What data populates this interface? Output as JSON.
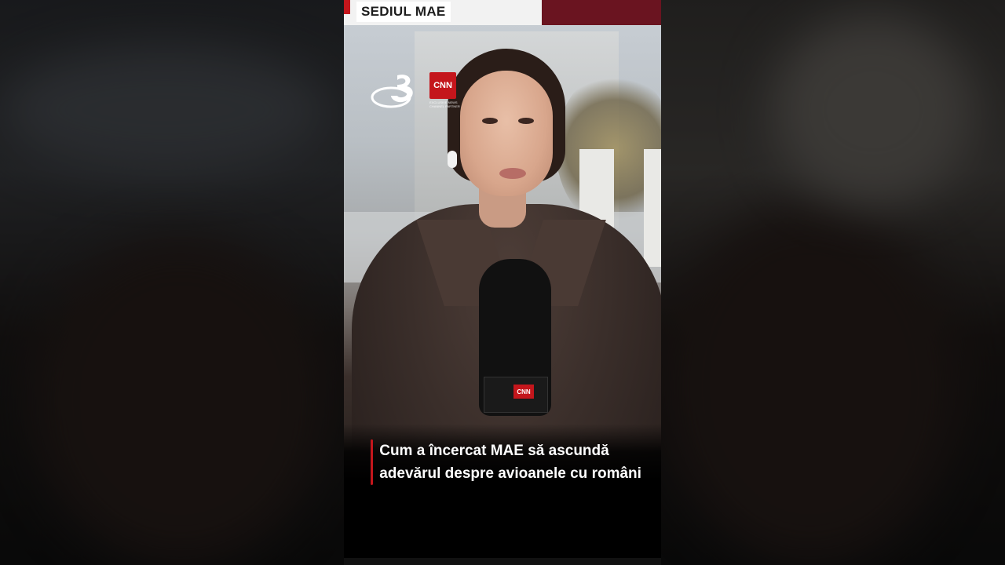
{
  "overlay": {
    "location_label": "SEDIUL MAE",
    "caption": "Cum a încercat MAE să ascundă adevărul despre avioanele cu români"
  },
  "logos": {
    "channel_logo_icon": "antena3-logo-icon",
    "partner_logo_text": "CNN",
    "partner_subtext": "EXCLUSIVE NEWS CHANNEL PARTNER"
  },
  "colors": {
    "accent_red": "#c4161c",
    "maroon": "#6a1420",
    "caption_text": "#ffffff"
  }
}
